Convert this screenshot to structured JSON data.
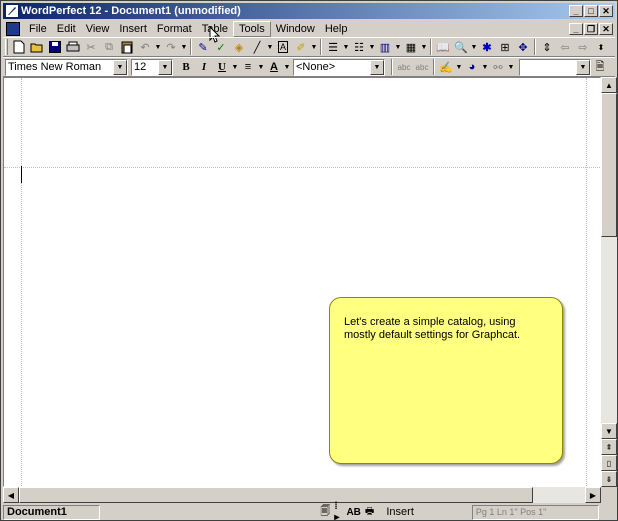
{
  "app": {
    "title": "WordPerfect 12 - Document1 (unmodified)"
  },
  "menu": {
    "items": [
      "File",
      "Edit",
      "View",
      "Insert",
      "Format",
      "Table",
      "Tools",
      "Window",
      "Help"
    ],
    "hover_index": 6
  },
  "format_bar": {
    "font_name": "Times New Roman",
    "font_size": "12",
    "bold_label": "B",
    "italic_label": "I",
    "underline_label": "U",
    "style_value": "<None>"
  },
  "callout": {
    "text": "Let's create a simple catalog, using mostly default settings for Graphcat."
  },
  "status": {
    "document": "Document1",
    "mode": "Insert",
    "position": "Pg 1 Ln 1\" Pos 1\""
  },
  "colors": {
    "titlebar_start": "#0a246a",
    "titlebar_end": "#a6caf0",
    "callout_bg": "#ffff80",
    "chrome": "#d4d0c8"
  }
}
